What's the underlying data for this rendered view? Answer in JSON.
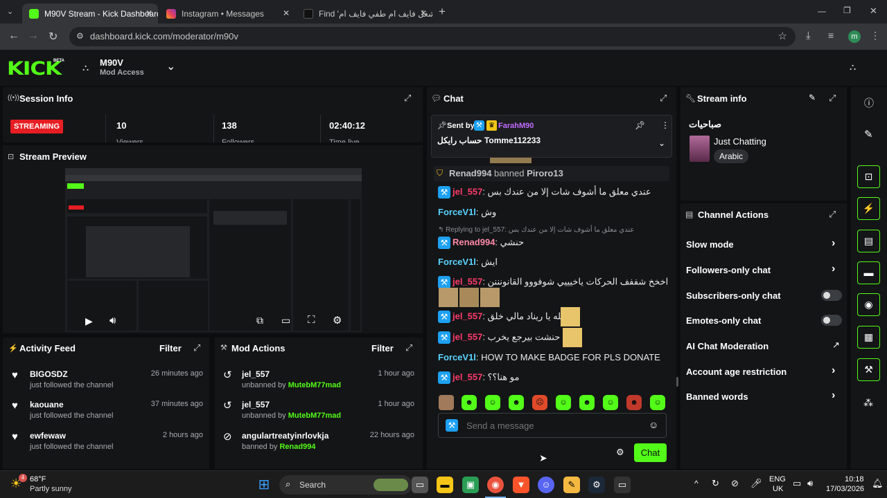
{
  "browser": {
    "tabs": [
      {
        "title": "M90V Stream - Kick Dashboard",
        "icon": "kick-favicon"
      },
      {
        "title": "Instagram • Messages",
        "icon": "instagram-favicon"
      },
      {
        "title": "Find 'شغل فايف ام طفي فايف ام",
        "icon": "tiktok-favicon"
      }
    ],
    "url": "dashboard.kick.com/moderator/m90v",
    "profile_initial": "m"
  },
  "header": {
    "logo": "KICK",
    "beta": "BETA",
    "channel_name": "M90V",
    "access": "Mod Access"
  },
  "session": {
    "title": "Session Info",
    "status": "STREAMING",
    "viewers": "10",
    "viewers_label": "Viewers",
    "followers": "138",
    "followers_label": "Followers",
    "time": "02:40:12",
    "time_label": "Time live"
  },
  "preview": {
    "title": "Stream Preview"
  },
  "activity": {
    "title": "Activity Feed",
    "filter": "Filter",
    "items": [
      {
        "user": "BIGOSDZ",
        "text": "just followed the channel",
        "time": "26 minutes ago"
      },
      {
        "user": "kaouane",
        "text": "just followed the channel",
        "time": "37 minutes ago"
      },
      {
        "user": "ewfewaw",
        "text": "just followed the channel",
        "time": "2 hours ago"
      }
    ]
  },
  "mod_actions": {
    "title": "Mod Actions",
    "filter": "Filter",
    "items": [
      {
        "user": "jel_557",
        "action": "unbanned by",
        "by": "MutebM77mad",
        "time": "1 hour ago"
      },
      {
        "user": "jel_557",
        "action": "unbanned by",
        "by": "MutebM77mad",
        "time": "1 hour ago"
      },
      {
        "user": "angulartreatyinrlovkja",
        "action": "banned by",
        "by": "Renad994",
        "time": "22 hours ago"
      }
    ]
  },
  "chat": {
    "title": "Chat",
    "pinned": {
      "sent_by": "Sent by",
      "user": "FarahM90",
      "message": "حساب رايكل Tomme112233"
    },
    "system": {
      "user": "Renad994",
      "action": "banned",
      "target": "Piroro13"
    },
    "messages": [
      {
        "user": "jel_557",
        "sep": ":",
        "text": "عندي معلق ما أشوف شات إلا من عندك بس",
        "color": "pink"
      },
      {
        "user": "ForceV1l",
        "sep": ":",
        "text": "وش",
        "color": "cyan"
      },
      {
        "user": "Renad994",
        "sep": ":",
        "text": "حنشي",
        "color": "pink",
        "reply": "Replying to jel_557: عندي معلق ما أشوف شات إلا من عندك بس"
      },
      {
        "user": "ForceV1l",
        "sep": ":",
        "text": "ايش",
        "color": "cyan"
      },
      {
        "user": "jel_557",
        "sep": ":",
        "text": "اخخخ شففف الحركات ياخيييي شوفووو القانونننن",
        "color": "pink"
      },
      {
        "user": "jel_557",
        "sep": ":",
        "text": "والله يا ريناد مالي خلق",
        "color": "pink"
      },
      {
        "user": "jel_557",
        "sep": ":",
        "text": "إذا حنشت بيرجع يخرب",
        "color": "pink"
      },
      {
        "user": "ForceV1l",
        "sep": ":",
        "text": "HOW TO MAKE BADGE FOR PLS DONATE",
        "color": "cyan"
      },
      {
        "user": "jel_557",
        "sep": ":",
        "text": "مو هنا؟؟",
        "color": "pink"
      }
    ],
    "placeholder": "Send a message",
    "send": "Chat"
  },
  "stream_info": {
    "title": "Stream info",
    "stream_title": "صباحيات",
    "category": "Just Chatting",
    "language": "Arabic"
  },
  "channel_actions": {
    "title": "Channel Actions",
    "items": [
      {
        "label": "Slow mode",
        "control": "chevron"
      },
      {
        "label": "Followers-only chat",
        "control": "chevron"
      },
      {
        "label": "Subscribers-only chat",
        "control": "toggle"
      },
      {
        "label": "Emotes-only chat",
        "control": "toggle"
      },
      {
        "label": "AI Chat Moderation",
        "control": "external"
      },
      {
        "label": "Account age restriction",
        "control": "chevron"
      },
      {
        "label": "Banned words",
        "control": "chevron"
      }
    ]
  },
  "taskbar": {
    "temp": "68°F",
    "weather": "Partly sunny",
    "weather_badge": "4",
    "search": "Search",
    "lang1": "ENG",
    "lang2": "UK",
    "time": "10:18",
    "date": "17/03/2026"
  },
  "colors": {
    "accent": "#53fc18",
    "pink": "#ff3b6b",
    "cyan": "#5ad3ff",
    "bg": "#0b0e0f",
    "panel": "#141517"
  }
}
